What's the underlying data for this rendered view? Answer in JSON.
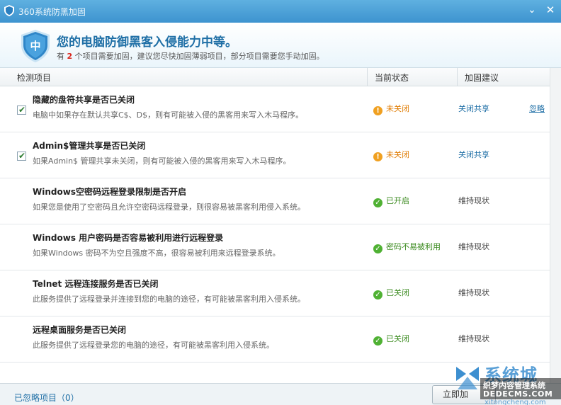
{
  "window": {
    "title": "360系统防黑加固",
    "minimize_glyph": "⌄",
    "close_glyph": "✕"
  },
  "header": {
    "shield_label": "中",
    "headline": "您的电脑防御黑客入侵能力中等。",
    "sub_prefix": "有 ",
    "sub_count": "2",
    "sub_suffix": " 个项目需要加固，建议您尽快加固薄弱项目，部分项目需要您手动加固。"
  },
  "columns": {
    "item": "检测项目",
    "status": "当前状态",
    "advice": "加固建议"
  },
  "rows": [
    {
      "checked": true,
      "title": "隐藏的盘符共享是否已关闭",
      "desc": "电脑中如果存在默认共享C$、D$，则有可能被入侵的黑客用来写入木马程序。",
      "status": "未关闭",
      "status_type": "warn",
      "advice": "关闭共享",
      "advice_link": true,
      "ignore": "忽略"
    },
    {
      "checked": true,
      "title": "Admin$管理共享是否已关闭",
      "desc": "如果Admin$ 管理共享未关闭，则有可能被入侵的黑客用来写入木马程序。",
      "status": "未关闭",
      "status_type": "warn",
      "advice": "关闭共享",
      "advice_link": true,
      "ignore": ""
    },
    {
      "checked": false,
      "title": "Windows空密码远程登录限制是否开启",
      "desc": "如果您是使用了空密码且允许空密码远程登录，则很容易被黑客利用侵入系统。",
      "status": "已开启",
      "status_type": "ok",
      "advice": "维持现状",
      "advice_link": false,
      "ignore": ""
    },
    {
      "checked": false,
      "title": "Windows 用户密码是否容易被利用进行远程登录",
      "desc": "如果Windows 密码不为空且强度不高，很容易被利用来远程登录系统。",
      "status": "密码不易被利用",
      "status_type": "ok",
      "advice": "维持现状",
      "advice_link": false,
      "ignore": ""
    },
    {
      "checked": false,
      "title": "Telnet 远程连接服务是否已关闭",
      "desc": "此服务提供了远程登录并连接到您的电脑的途径，有可能被黑客利用入侵系统。",
      "status": "已关闭",
      "status_type": "ok",
      "advice": "维持现状",
      "advice_link": false,
      "ignore": ""
    },
    {
      "checked": false,
      "title": "远程桌面服务是否已关闭",
      "desc": "此服务提供了远程登录您的电脑的途径，有可能被黑客利用入侵系统。",
      "status": "已关闭",
      "status_type": "ok",
      "advice": "维持现状",
      "advice_link": false,
      "ignore": ""
    }
  ],
  "footer": {
    "ignored_items": "已忽略项目（0）",
    "fix_button": "立即加"
  },
  "watermark": {
    "big": "系统城",
    "line1": "织梦内容管理系统",
    "line2": "DEDECMS.COM",
    "small": "xitongcheng.com"
  },
  "colors": {
    "accent": "#1f6fa6",
    "warn": "#e07b00",
    "ok": "#3a8a1e",
    "title_bar": "#3d93cf"
  }
}
